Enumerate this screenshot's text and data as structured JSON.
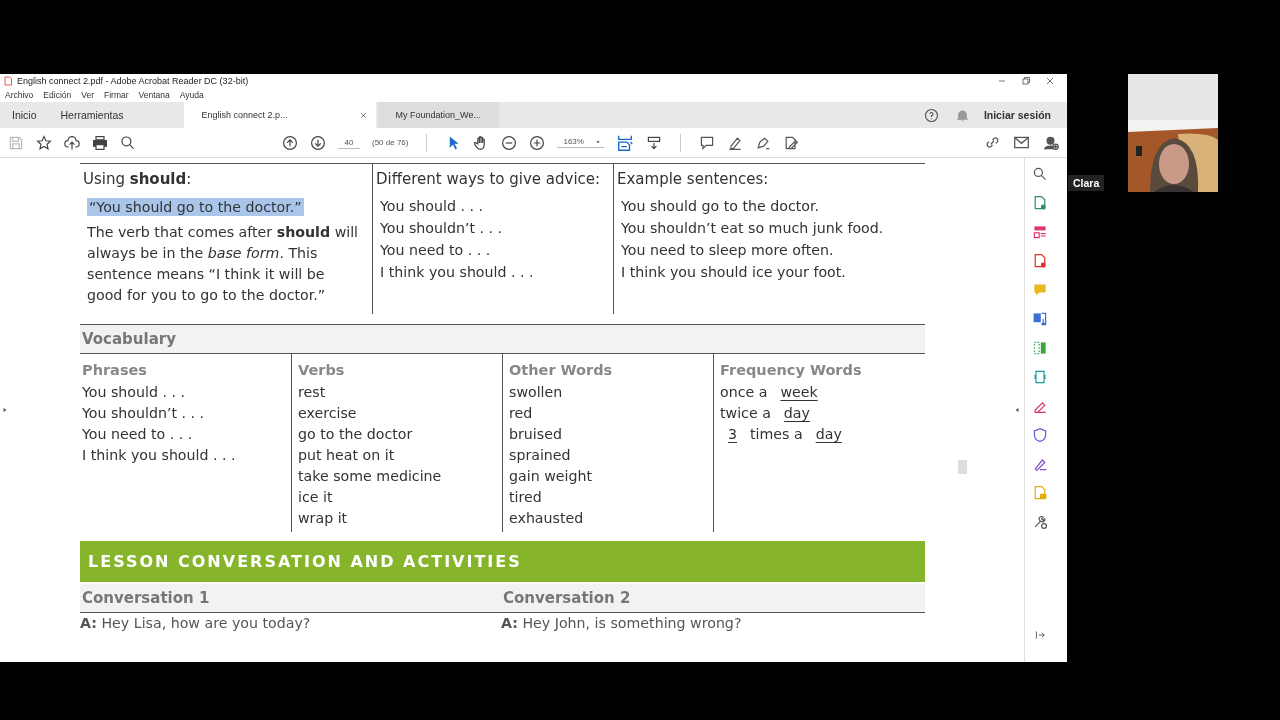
{
  "window": {
    "title": "English connect 2.pdf - Adobe Acrobat Reader DC (32-bit)",
    "menu": [
      "Archivo",
      "Edición",
      "Ver",
      "Firmar",
      "Ventana",
      "Ayuda"
    ],
    "nav_tabs": [
      "Inicio",
      "Herramientas"
    ],
    "doc_tabs": [
      {
        "label": "English connect 2.p...",
        "selected": true
      },
      {
        "label": "My Foundation_We...",
        "selected": false
      }
    ],
    "sign_in": "Iniciar sesión"
  },
  "toolbar": {
    "page": "40",
    "page_info": "(50 de 76)",
    "zoom": "163%"
  },
  "advice_table": {
    "headers": [
      "Using **should**:",
      "Different ways to give advice:",
      "Example sentences:"
    ],
    "quote": {
      "text": "“You should go to the doctor.”",
      "highlighted": true
    },
    "explanation": "The verb that comes after **should** will always be in the *base form*. This sentence means “I think it will be good for you to go to the doctor.”",
    "ways": [
      "You should . . .",
      "You shouldn’t . . .",
      "You need to . . .",
      "I think you should . . ."
    ],
    "examples": [
      "You should go to the doctor.",
      "You shouldn’t eat so much junk food.",
      "You need to sleep more often.",
      "I think you should ice your foot."
    ]
  },
  "vocabulary": {
    "title": "Vocabulary",
    "columns": [
      {
        "heading": "Phrases",
        "items": [
          [
            {
              "kind": "plain",
              "text": "You should . . ."
            }
          ],
          [
            {
              "kind": "plain",
              "text": "You shouldn’t . . ."
            }
          ],
          [
            {
              "kind": "plain",
              "text": "You need to . . ."
            }
          ],
          [
            {
              "kind": "plain",
              "text": "I think you should . . ."
            }
          ]
        ]
      },
      {
        "heading": "Verbs",
        "items": [
          [
            {
              "kind": "plain",
              "text": "rest"
            }
          ],
          [
            {
              "kind": "plain",
              "text": "exercise"
            }
          ],
          [
            {
              "kind": "plain",
              "text": "go to the doctor"
            }
          ],
          [
            {
              "kind": "plain",
              "text": "put heat on it"
            }
          ],
          [
            {
              "kind": "plain",
              "text": "take some medicine"
            }
          ],
          [
            {
              "kind": "plain",
              "text": "ice it"
            }
          ],
          [
            {
              "kind": "plain",
              "text": "wrap it"
            }
          ]
        ]
      },
      {
        "heading": "Other Words",
        "items": [
          [
            {
              "kind": "plain",
              "text": "swollen"
            }
          ],
          [
            {
              "kind": "plain",
              "text": "red"
            }
          ],
          [
            {
              "kind": "plain",
              "text": "bruised"
            }
          ],
          [
            {
              "kind": "plain",
              "text": "sprained"
            }
          ],
          [
            {
              "kind": "plain",
              "text": "gain weight"
            }
          ],
          [
            {
              "kind": "plain",
              "text": "tired"
            }
          ],
          [
            {
              "kind": "plain",
              "text": "exhausted"
            }
          ]
        ]
      },
      {
        "heading": "Frequency Words",
        "items": [
          [
            {
              "kind": "plain",
              "text": "once a"
            },
            {
              "kind": "blank",
              "text": "week"
            }
          ],
          [
            {
              "kind": "plain",
              "text": "twice a"
            },
            {
              "kind": "blank",
              "text": "day"
            }
          ],
          [
            {
              "kind": "blank",
              "text": "3"
            },
            {
              "kind": "plain",
              "text": "times a"
            },
            {
              "kind": "blank",
              "text": "day"
            }
          ]
        ]
      }
    ]
  },
  "banner": "LESSON CONVERSATION AND ACTIVITIES",
  "conversations": [
    {
      "heading": "Conversation 1",
      "speaker": "A:",
      "line": "Hey Lisa, how are you today?"
    },
    {
      "heading": "Conversation 2",
      "speaker": "A:",
      "line": "Hey John, is something wrong?"
    }
  ],
  "video": {
    "name": "Clara"
  }
}
